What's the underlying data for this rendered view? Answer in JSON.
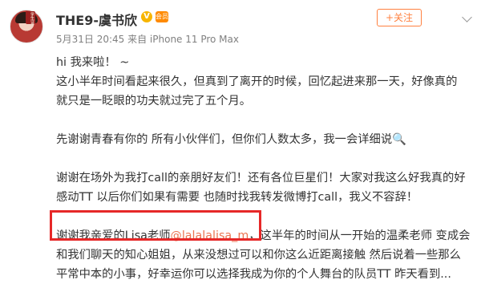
{
  "post": {
    "username": "THE9-虞书欣",
    "verified_badge": "V",
    "vip_badge": "会员",
    "meta": "5月31日 20:45 来自 iPhone 11 Pro Max",
    "follow_label": "+关注"
  },
  "content": {
    "line1": "hi 我来啦！ ~",
    "line2": "这小半年时间看起来很久，但真到了离开的时候，回忆起进来那一天，好像真的",
    "line3": "就只是一眨眼的功夫就过完了五个月。",
    "line4": "先谢谢青春有你的 所有小伙伴们，但你们人数太多，我一会详细说🔍",
    "line5": "谢谢在场外为我打call的亲朋好友们！还有各位巨星们！大家对我这么好我真的好",
    "line6": "感动TT 以后你们如果有需要 也随时找我转发微博打call，我义不容辞！",
    "line7_prefix": "谢谢我亲爱的Lisa老师",
    "line7_mention": "@lalalalisa_m",
    "line7_suffix": "，这半年的时间从一开始的温柔老师 变成会",
    "line8": "和我们聊天的知心姐姐，从来没想过可以和你这么近距离接触 然后说着一些那么",
    "line9": "平常中本的小事，好幸运你可以选择我成为你的个人舞台的队员TT 昨天看到..."
  },
  "colors": {
    "accent": "#ff8140",
    "mention": "#eb7350",
    "highlight_border": "#e62828"
  }
}
